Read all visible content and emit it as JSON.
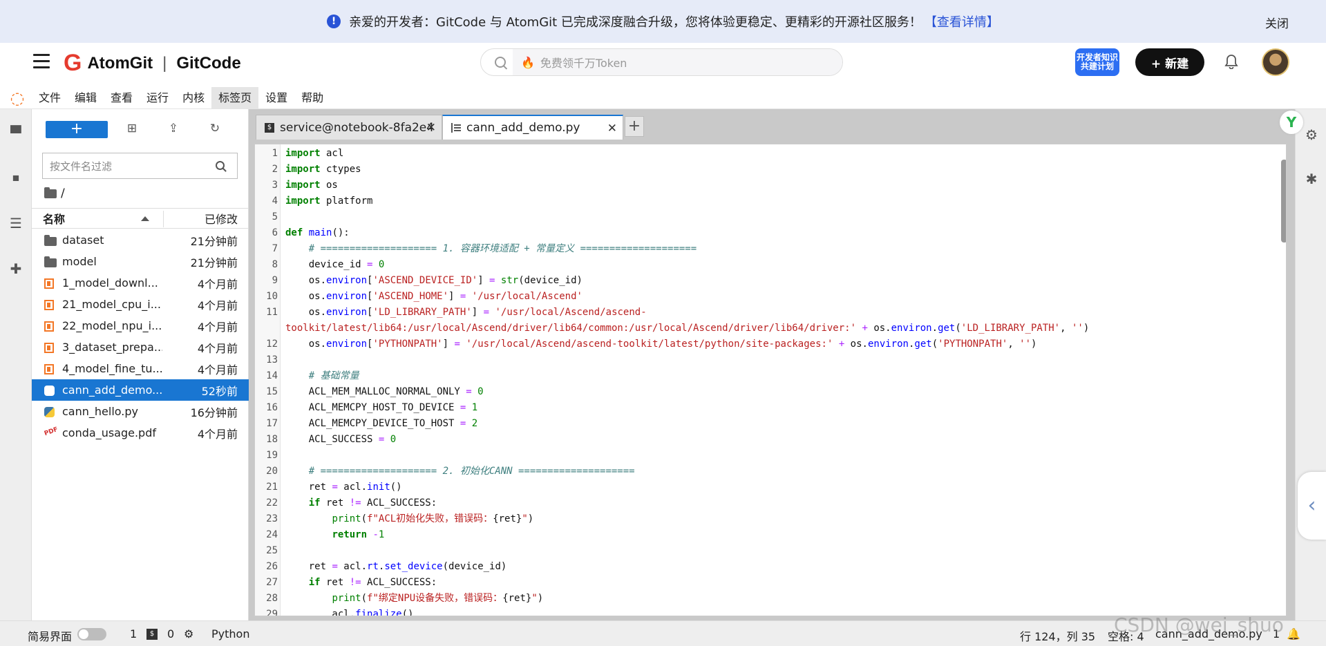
{
  "banner": {
    "message": "亲爱的开发者：GitCode 与 AtomGit 已完成深度融合升级，您将体验更稳定、更精彩的开源社区服务！",
    "link": "【查看详情】",
    "close": "关闭"
  },
  "header": {
    "brand1": "AtomGit",
    "brand_sep": "|",
    "brand2": "GitCode",
    "search_placeholder": "免费领千万Token",
    "dev_badge": "开发者知识共建计划",
    "new_button": "+ 新建"
  },
  "menu": [
    "文件",
    "编辑",
    "查看",
    "运行",
    "内核",
    "标签页",
    "设置",
    "帮助"
  ],
  "filebrowser": {
    "filter_placeholder": "按文件名过滤",
    "path": "/",
    "col_name": "名称",
    "col_modified": "已修改",
    "files": [
      {
        "name": "dataset",
        "time": "21分钟前",
        "type": "folder"
      },
      {
        "name": "model",
        "time": "21分钟前",
        "type": "folder"
      },
      {
        "name": "1_model_downl...",
        "time": "4个月前",
        "type": "notebook"
      },
      {
        "name": "21_model_cpu_i...",
        "time": "4个月前",
        "type": "notebook"
      },
      {
        "name": "22_model_npu_i...",
        "time": "4个月前",
        "type": "notebook"
      },
      {
        "name": "3_dataset_prepa...",
        "time": "4个月前",
        "type": "notebook"
      },
      {
        "name": "4_model_fine_tu...",
        "time": "4个月前",
        "type": "notebook"
      },
      {
        "name": "cann_add_demo...",
        "time": "52秒前",
        "type": "python",
        "selected": true
      },
      {
        "name": "cann_hello.py",
        "time": "16分钟前",
        "type": "python"
      },
      {
        "name": "conda_usage.pdf",
        "time": "4个月前",
        "type": "pdf"
      }
    ]
  },
  "tabs": [
    {
      "label": "service@notebook-8fa2e4",
      "icon": "terminal-icon"
    },
    {
      "label": "cann_add_demo.py",
      "icon": "text-file-icon",
      "active": true
    }
  ],
  "code_lines": [
    {
      "n": "1",
      "html": "<span class='kw'>import</span> acl"
    },
    {
      "n": "2",
      "html": "<span class='kw'>import</span> ctypes"
    },
    {
      "n": "3",
      "html": "<span class='kw'>import</span> os"
    },
    {
      "n": "4",
      "html": "<span class='kw'>import</span> platform"
    },
    {
      "n": "5",
      "html": ""
    },
    {
      "n": "6",
      "html": "<span class='kw'>def</span> <span class='fn'>main</span>():"
    },
    {
      "n": "7",
      "html": "    <span class='cm'># ==================== 1. 容器环境适配 + 常量定义 ====================</span>"
    },
    {
      "n": "8",
      "html": "    device_id <span class='op'>=</span> <span class='num'>0</span>"
    },
    {
      "n": "9",
      "html": "    os.<span class='fn'>environ</span>[<span class='str'>'ASCEND_DEVICE_ID'</span>] <span class='op'>=</span> <span class='bi'>str</span>(device_id)"
    },
    {
      "n": "10",
      "html": "    os.<span class='fn'>environ</span>[<span class='str'>'ASCEND_HOME'</span>] <span class='op'>=</span> <span class='str'>'/usr/local/Ascend'</span>"
    },
    {
      "n": "11",
      "html": "    os.<span class='fn'>environ</span>[<span class='str'>'LD_LIBRARY_PATH'</span>] <span class='op'>=</span> <span class='str'>'/usr/local/Ascend/ascend-</span>"
    },
    {
      "n": "",
      "html": "<span class='str'>toolkit/latest/lib64:/usr/local/Ascend/driver/lib64/common:/usr/local/Ascend/driver/lib64/driver:'</span> <span class='op'>+</span> os.<span class='fn'>environ</span>.<span class='fn'>get</span>(<span class='str'>'LD_LIBRARY_PATH'</span>, <span class='str'>''</span>)"
    },
    {
      "n": "12",
      "html": "    os.<span class='fn'>environ</span>[<span class='str'>'PYTHONPATH'</span>] <span class='op'>=</span> <span class='str'>'/usr/local/Ascend/ascend-toolkit/latest/python/site-packages:'</span> <span class='op'>+</span> os.<span class='fn'>environ</span>.<span class='fn'>get</span>(<span class='str'>'PYTHONPATH'</span>, <span class='str'>''</span>)"
    },
    {
      "n": "13",
      "html": ""
    },
    {
      "n": "14",
      "html": "    <span class='cm'># 基础常量</span>"
    },
    {
      "n": "15",
      "html": "    ACL_MEM_MALLOC_NORMAL_ONLY <span class='op'>=</span> <span class='num'>0</span>"
    },
    {
      "n": "16",
      "html": "    ACL_MEMCPY_HOST_TO_DEVICE <span class='op'>=</span> <span class='num'>1</span>"
    },
    {
      "n": "17",
      "html": "    ACL_MEMCPY_DEVICE_TO_HOST <span class='op'>=</span> <span class='num'>2</span>"
    },
    {
      "n": "18",
      "html": "    ACL_SUCCESS <span class='op'>=</span> <span class='num'>0</span>"
    },
    {
      "n": "19",
      "html": ""
    },
    {
      "n": "20",
      "html": "    <span class='cm'># ==================== 2. 初始化CANN ====================</span>"
    },
    {
      "n": "21",
      "html": "    ret <span class='op'>=</span> acl.<span class='fn'>init</span>()"
    },
    {
      "n": "22",
      "html": "    <span class='kw'>if</span> ret <span class='op'>!=</span> ACL_SUCCESS:"
    },
    {
      "n": "23",
      "html": "        <span class='bi'>print</span>(<span class='str'>f\"ACL初始化失败，错误码：</span>{ret}<span class='str'>\"</span>)"
    },
    {
      "n": "24",
      "html": "        <span class='kw'>return</span> <span class='op'>-</span><span class='num'>1</span>"
    },
    {
      "n": "25",
      "html": ""
    },
    {
      "n": "26",
      "html": "    ret <span class='op'>=</span> acl.<span class='fn'>rt</span>.<span class='fn'>set_device</span>(device_id)"
    },
    {
      "n": "27",
      "html": "    <span class='kw'>if</span> ret <span class='op'>!=</span> ACL_SUCCESS:"
    },
    {
      "n": "28",
      "html": "        <span class='bi'>print</span>(<span class='str'>f\"绑定NPU设备失败，错误码：</span>{ret}<span class='str'>\"</span>)"
    },
    {
      "n": "29",
      "html": "        acl.<span class='fn'>finalize</span>()"
    }
  ],
  "status": {
    "simple_mode": "简易界面",
    "count1": "1",
    "count2": "0",
    "kernel": "Python",
    "cursor": "行 124，列 35",
    "spaces": "空格: 4",
    "filename": "cann_add_demo.py",
    "extra": "1"
  },
  "watermark": "CSDN @wei_shuo",
  "colors": {
    "accent": "#1976d2",
    "brand": "#e53b2e",
    "jupyter": "#f37726"
  }
}
